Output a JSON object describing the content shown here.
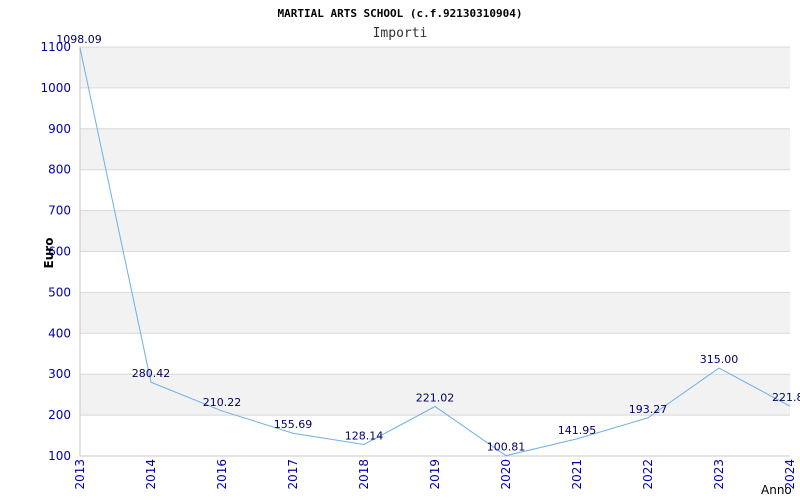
{
  "chart_data": {
    "type": "line",
    "title": "MARTIAL ARTS SCHOOL (c.f.92130310904)",
    "subtitle": "Importi",
    "ylabel": "Euro",
    "xlabel": "Anno",
    "x": [
      "2013",
      "2014",
      "2016",
      "2017",
      "2018",
      "2019",
      "2020",
      "2021",
      "2022",
      "2023",
      "2024"
    ],
    "values": [
      1098.09,
      280.42,
      210.22,
      155.69,
      128.14,
      221.02,
      100.81,
      141.95,
      193.27,
      315.0,
      221.8
    ],
    "value_labels": [
      "1098.09",
      "280.42",
      "210.22",
      "155.69",
      "128.14",
      "221.02",
      "100.81",
      "141.95",
      "193.27",
      "315.00",
      "221.8"
    ],
    "yticks": [
      "100",
      "200",
      "300",
      "400",
      "500",
      "600",
      "700",
      "800",
      "900",
      "1000",
      "1100"
    ],
    "ylim": [
      100,
      1100
    ],
    "grid": "horizontal alternating bands",
    "colors": {
      "line": "#6cb0e8",
      "band": "#f2f2f2",
      "gridline": "#d8d8d8",
      "tick_text": "#0000aa",
      "data_label_text": "#000066"
    }
  }
}
